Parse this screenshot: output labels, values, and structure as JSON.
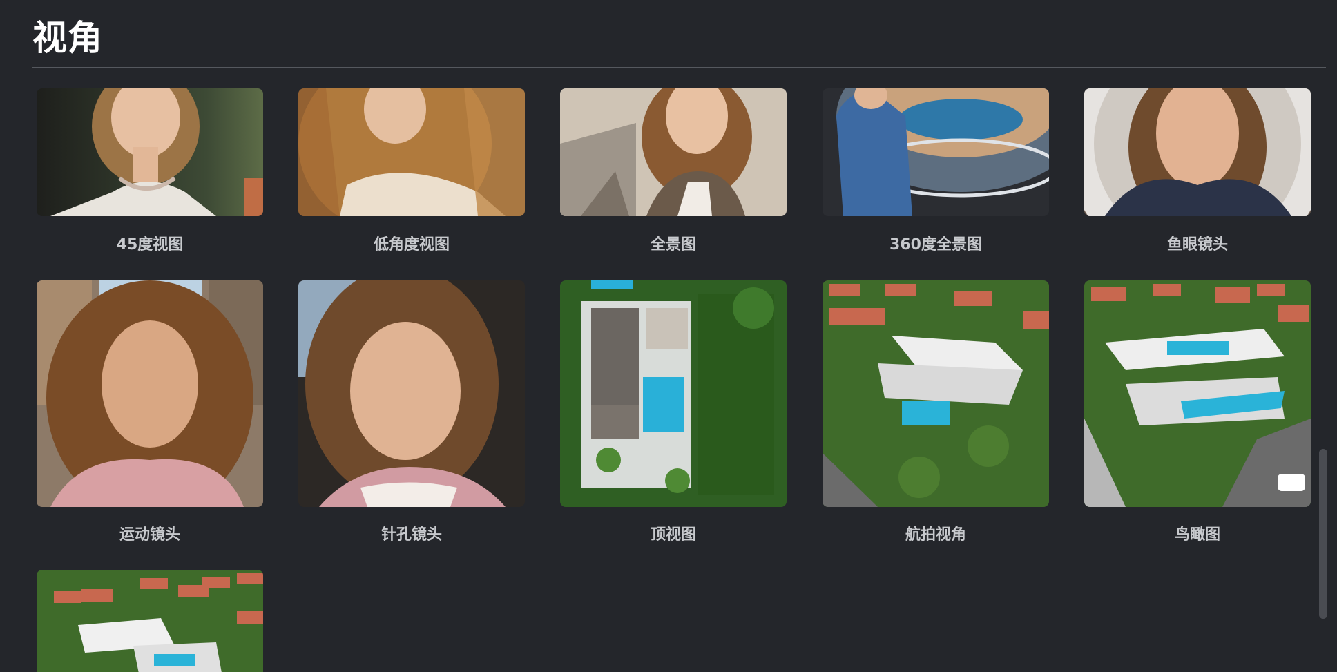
{
  "section": {
    "title": "视角"
  },
  "items": [
    {
      "label": "45度视图",
      "icon": "portrait-45-degree-image"
    },
    {
      "label": "低角度视图",
      "icon": "portrait-low-angle-image"
    },
    {
      "label": "全景图",
      "icon": "portrait-panorama-image"
    },
    {
      "label": "360度全景图",
      "icon": "fisheye-360-panorama-image"
    },
    {
      "label": "鱼眼镜头",
      "icon": "fisheye-lens-portrait-image"
    },
    {
      "label": "运动镜头",
      "icon": "motion-lens-portrait-image"
    },
    {
      "label": "针孔镜头",
      "icon": "pinhole-lens-portrait-image"
    },
    {
      "label": "顶视图",
      "icon": "top-view-villa-image"
    },
    {
      "label": "航拍视角",
      "icon": "aerial-villa-image"
    },
    {
      "label": "鸟瞰图",
      "icon": "birds-eye-villa-image"
    },
    {
      "label": "",
      "icon": "villa-partial-image"
    }
  ],
  "colors": {
    "background": "#24262b",
    "title": "#ffffff",
    "caption": "#c7c9cd",
    "divider": "#55585e"
  }
}
